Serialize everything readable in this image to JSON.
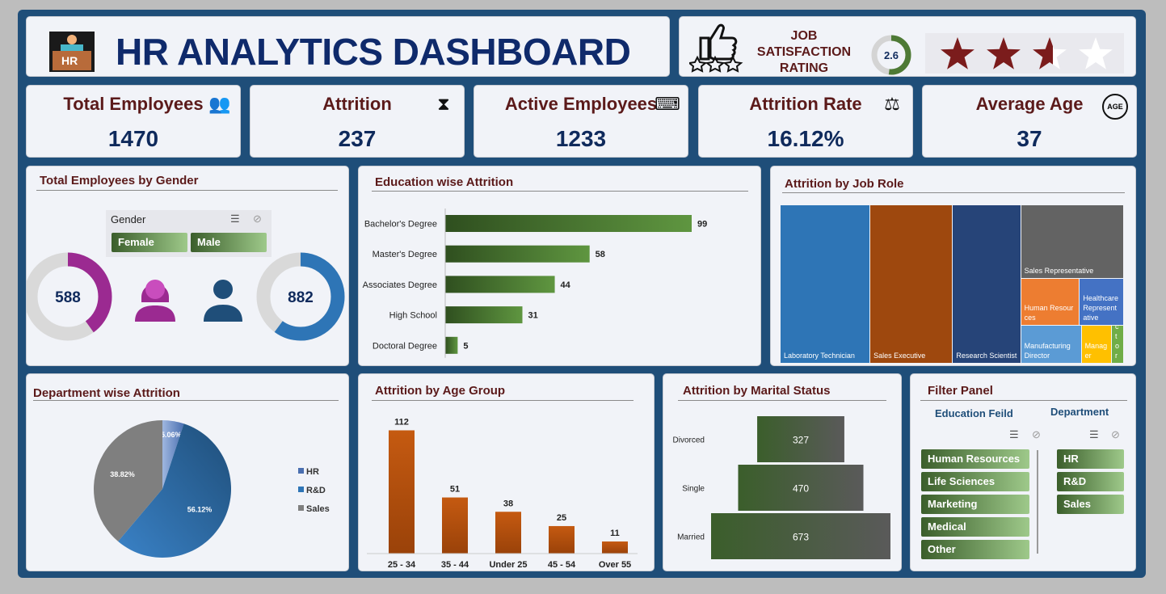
{
  "header": {
    "title": "HR ANALYTICS DASHBOARD",
    "logo_text": "HR"
  },
  "satisfaction": {
    "label_line1": "JOB",
    "label_line2": "SATISFACTION",
    "label_line3": "RATING",
    "rating": 2.6,
    "rating_text": "2.6",
    "max_stars": 5
  },
  "kpis": [
    {
      "title": "Total  Employees",
      "value": "1470",
      "icon": "people-group-icon"
    },
    {
      "title": "Attrition",
      "value": "237",
      "icon": "attrition-people-icon"
    },
    {
      "title": "Active Employees",
      "value": "1233",
      "icon": "employee-at-desk-icon"
    },
    {
      "title": "Attrition Rate",
      "value": "16.12%",
      "icon": "balance-person-icon"
    },
    {
      "title": "Average  Age",
      "value": "37",
      "icon": "age-icon"
    }
  ],
  "age_icon_text": "AGE",
  "gender": {
    "title": "Total Employees by Gender",
    "slicer_header": "Gender",
    "female_label": "Female",
    "male_label": "Male",
    "female_value": 588,
    "male_value": 882,
    "female_text": "588",
    "male_text": "882",
    "total": 1470
  },
  "colors": {
    "frame": "#1f4e79",
    "title": "#5b1a1a",
    "value": "#0f2a5c",
    "green": "#4e7a35",
    "orange": "#c55a11",
    "female": "#9b2a91",
    "male": "#2e75b6"
  },
  "education_attrition": {
    "title": "Education wise Attrition"
  },
  "job_role": {
    "title": "Attrition by Job Role"
  },
  "department": {
    "title": "Department wise Attrition"
  },
  "age_group": {
    "title": "Attrition  by Age Group"
  },
  "marital": {
    "title": "Attrition  by Marital Status"
  },
  "filter": {
    "title": "Filter Panel",
    "education_header": "Education Feild",
    "department_header": "Department",
    "education_items": [
      "Human Resources",
      "Life Sciences",
      "Marketing",
      "Medical",
      "Other"
    ],
    "department_items": [
      "HR",
      "R&D",
      "Sales"
    ]
  },
  "chart_data": [
    {
      "type": "bar",
      "orientation": "horizontal",
      "title": "Education wise Attrition",
      "categories": [
        "Bachelor's Degree",
        "Master's Degree",
        "Associates Degree",
        "High School",
        "Doctoral Degree"
      ],
      "values": [
        99,
        58,
        44,
        31,
        5
      ],
      "xlim": [
        0,
        110
      ]
    },
    {
      "type": "treemap",
      "title": "Attrition by Job Role",
      "categories": [
        "Laboratory Technician",
        "Sales Executive",
        "Research Scientist",
        "Sales Representative",
        "Human Resources",
        "Healthcare Representative",
        "Manufacturing Director",
        "Manager",
        "Research Director"
      ],
      "values": [
        62,
        57,
        47,
        33,
        12,
        9,
        10,
        5,
        2
      ]
    },
    {
      "type": "pie",
      "title": "Department wise Attrition",
      "categories": [
        "HR",
        "R&D",
        "Sales"
      ],
      "values": [
        5.06,
        56.12,
        38.82
      ],
      "labels": [
        "5.06%",
        "56.12%",
        "38.82%"
      ],
      "legend": "right"
    },
    {
      "type": "bar",
      "title": "Attrition  by Age Group",
      "categories": [
        "25 - 34",
        "35 - 44",
        "Under 25",
        "45 - 54",
        "Over 55"
      ],
      "values": [
        112,
        51,
        38,
        25,
        11
      ],
      "ylim": [
        0,
        120
      ]
    },
    {
      "type": "bar",
      "orientation": "horizontal",
      "style": "funnel",
      "title": "Attrition  by Marital Status",
      "categories": [
        "Divorced",
        "Single",
        "Married"
      ],
      "values": [
        327,
        470,
        673
      ]
    }
  ]
}
